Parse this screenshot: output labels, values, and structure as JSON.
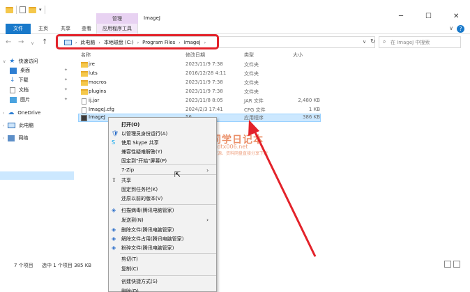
{
  "window": {
    "title": "ImageJ",
    "context_tab_group": "管理",
    "tabs": [
      "文件",
      "主页",
      "共享",
      "查看",
      "应用程序工具"
    ]
  },
  "address": {
    "crumbs": [
      "此电脑",
      "本地磁盘 (C:)",
      "Program Files",
      "ImageJ"
    ],
    "search_placeholder": "在 ImageJ 中搜索"
  },
  "sidebar": {
    "items": [
      "快速访问",
      "桌面",
      "下载",
      "文档",
      "图片",
      "OneDrive",
      "此电脑",
      "网络"
    ]
  },
  "columns": [
    "名称",
    "修改日期",
    "类型",
    "大小"
  ],
  "files": [
    {
      "name": "jre",
      "date": "2023/11/9 7:38",
      "type": "文件夹",
      "size": "",
      "icon": "folder"
    },
    {
      "name": "luts",
      "date": "2016/12/28 4:11",
      "type": "文件夹",
      "size": "",
      "icon": "folder"
    },
    {
      "name": "macros",
      "date": "2023/11/9 7:38",
      "type": "文件夹",
      "size": "",
      "icon": "folder"
    },
    {
      "name": "plugins",
      "date": "2023/11/9 7:38",
      "type": "文件夹",
      "size": "",
      "icon": "folder"
    },
    {
      "name": "ij.jar",
      "date": "2023/11/8 8:05",
      "type": "JAR 文件",
      "size": "2,480 KB",
      "icon": "file"
    },
    {
      "name": "ImageJ.cfg",
      "date": "2024/2/3 17:41",
      "type": "CFG 文件",
      "size": "1 KB",
      "icon": "file"
    },
    {
      "name": "ImageJ",
      "date": "56",
      "type": "应用程序",
      "size": "386 KB",
      "icon": "app"
    }
  ],
  "status": {
    "count": "7 个项目",
    "selected": "选中 1 个项目  385 KB"
  },
  "context_menu": {
    "items": [
      {
        "label": "打开(O)",
        "bold": true
      },
      {
        "label": "以管理员身份运行(A)",
        "icon": "shield-icon"
      },
      {
        "label": "使用 Skype 共享",
        "icon": "skype-icon"
      },
      {
        "label": "兼容性疑难解答(Y)"
      },
      {
        "label": "固定到\"开始\"屏幕(P)"
      },
      {
        "label": "7-Zip",
        "submenu": true
      },
      {
        "label": "共享",
        "icon": "share-icon"
      },
      {
        "label": "固定到任务栏(K)"
      },
      {
        "label": "还原以前的版本(V)"
      },
      {
        "label": "扫描病毒(腾讯电脑管家)",
        "icon": "tencent-icon"
      },
      {
        "label": "发送到(N)",
        "submenu": true
      },
      {
        "label": "删除文件(腾讯电脑管家)",
        "icon": "tencent-icon"
      },
      {
        "label": "解除文件占用(腾讯电脑管家)",
        "icon": "tencent-icon"
      },
      {
        "label": "粉碎文件(腾讯电脑管家)",
        "icon": "tencent-icon"
      },
      {
        "label": "剪切(T)"
      },
      {
        "label": "复制(C)"
      },
      {
        "label": "创建快捷方式(S)"
      },
      {
        "label": "删除(D)"
      }
    ]
  },
  "watermark": {
    "title": "丁同学日记本",
    "url": "www.dtx006.net",
    "sub": "软件、资源、资料网盘直接分享下载"
  },
  "colors": {
    "accent": "#1979ca",
    "annotation": "#e3222a",
    "selection": "#cce8ff"
  }
}
